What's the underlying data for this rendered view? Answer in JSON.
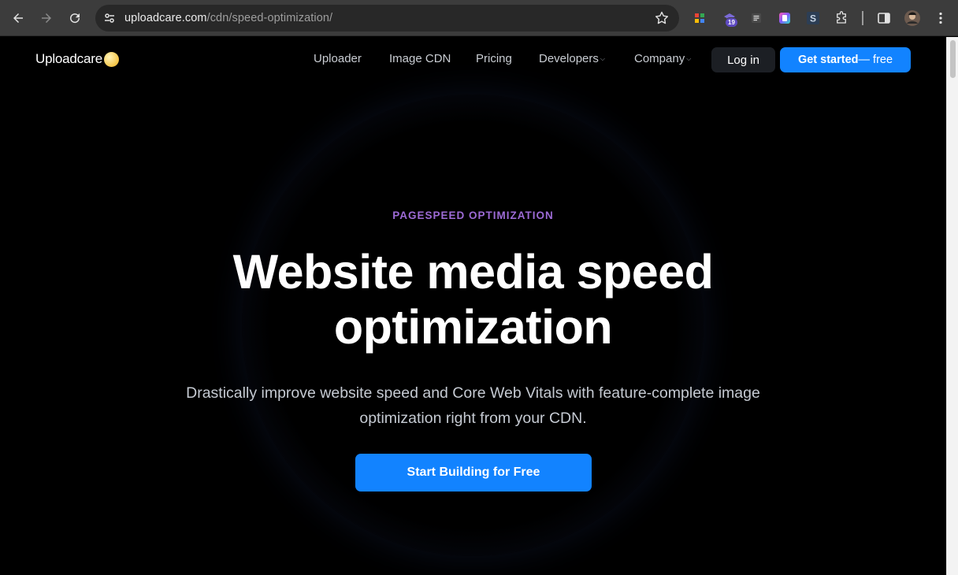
{
  "browser": {
    "url_host": "uploadcare.com",
    "url_path": "/cdn/speed-optimization/",
    "extension_badge": "19"
  },
  "site": {
    "logo_text": "Uploadcare",
    "nav": [
      {
        "label": "Uploader"
      },
      {
        "label": "Image CDN"
      },
      {
        "label": "Pricing"
      },
      {
        "label": "Developers"
      },
      {
        "label": "Company"
      }
    ],
    "login_label": "Log in",
    "get_started_label": "Get started",
    "get_started_suffix": " — free"
  },
  "hero": {
    "eyebrow": "PAGESPEED OPTIMIZATION",
    "headline_line1": "Website media speed",
    "headline_line2": "optimization",
    "subtext": "Drastically improve website speed and Core Web Vitals with feature-complete image optimization right from your CDN.",
    "cta_label": "Start Building for Free"
  },
  "colors": {
    "accent_blue": "#1283ff",
    "eyebrow_purple": "#9d6bd6",
    "background": "#000000"
  }
}
